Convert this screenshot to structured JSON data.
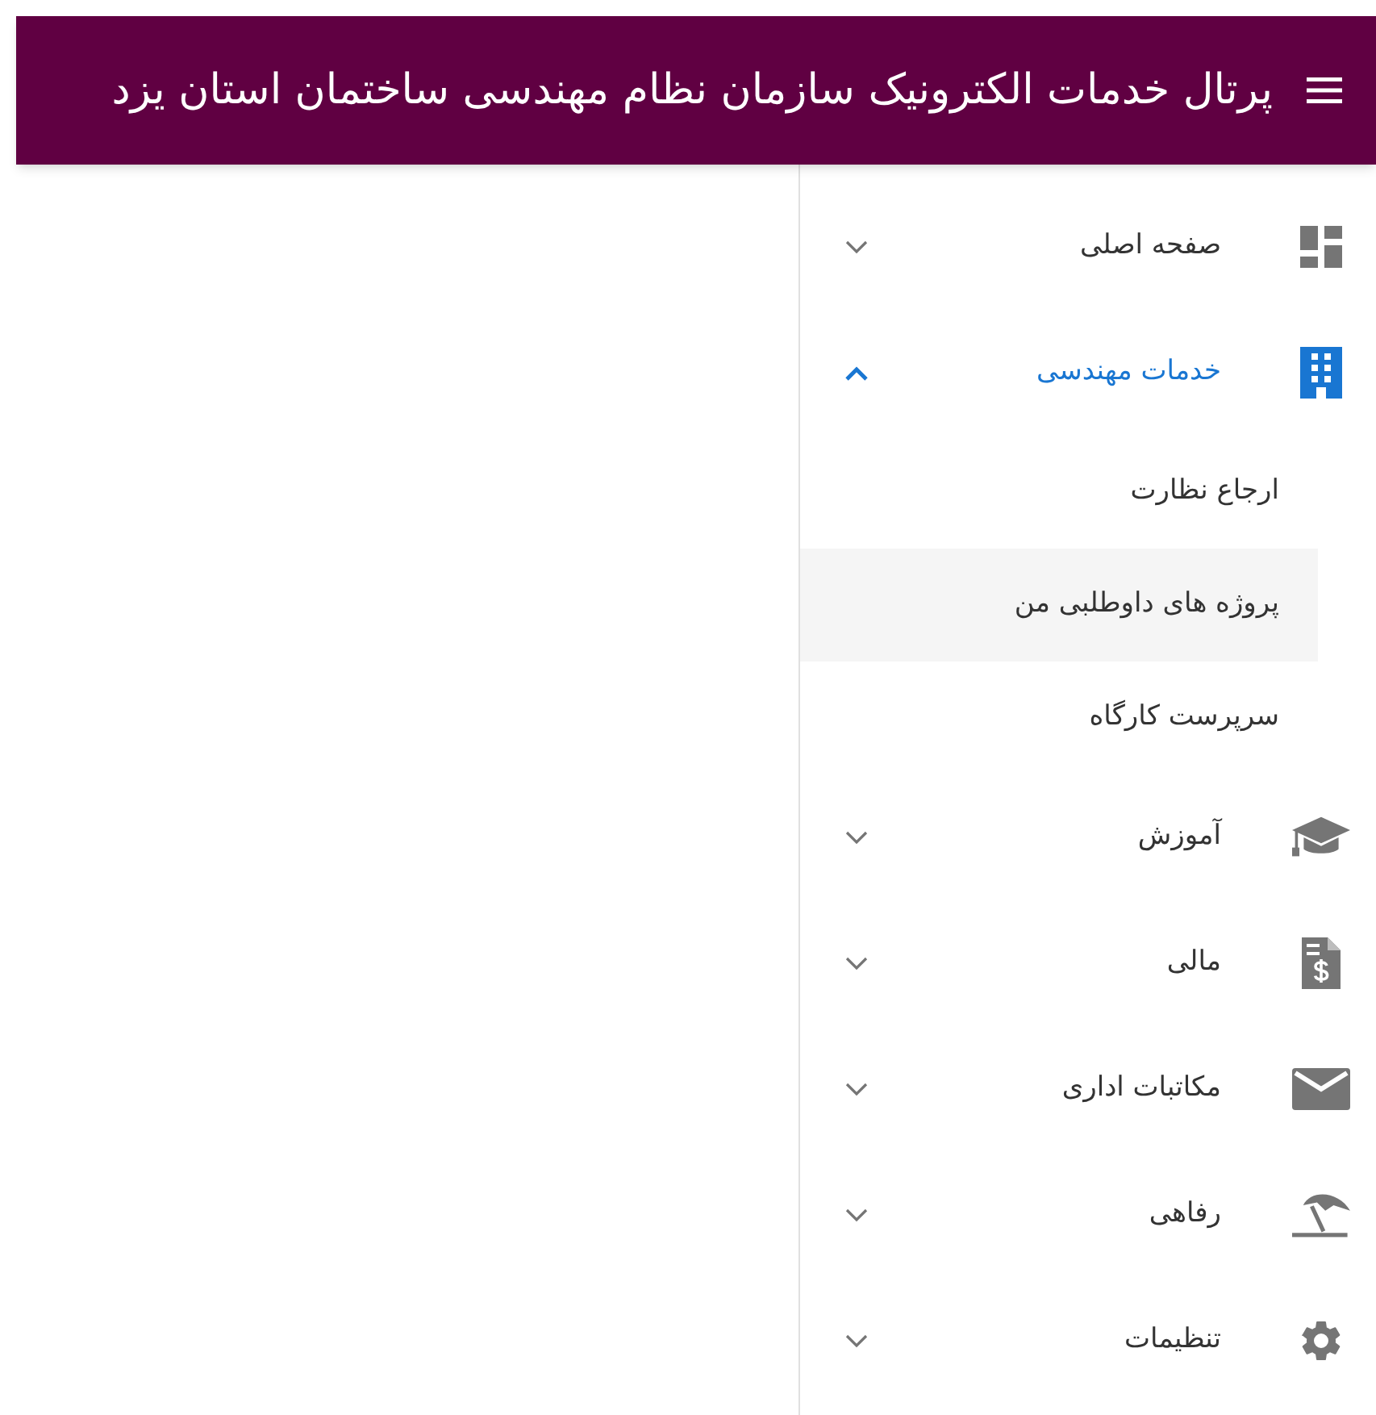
{
  "header": {
    "title": "پرتال خدمات الکترونیک سازمان نظام مهندسی ساختمان استان یزد"
  },
  "sidebar": {
    "items": [
      {
        "label": "صفحه اصلی",
        "expanded": false
      },
      {
        "label": "خدمات مهندسی",
        "expanded": true,
        "children": [
          {
            "label": "ارجاع نظارت",
            "selected": false
          },
          {
            "label": "پروژه های داوطلبی من",
            "selected": true
          },
          {
            "label": "سرپرست کارگاه",
            "selected": false
          }
        ]
      },
      {
        "label": "آموزش",
        "expanded": false
      },
      {
        "label": "مالی",
        "expanded": false
      },
      {
        "label": "مکاتبات اداری",
        "expanded": false
      },
      {
        "label": "رفاهی",
        "expanded": false
      },
      {
        "label": "تنظیمات",
        "expanded": false
      }
    ]
  }
}
